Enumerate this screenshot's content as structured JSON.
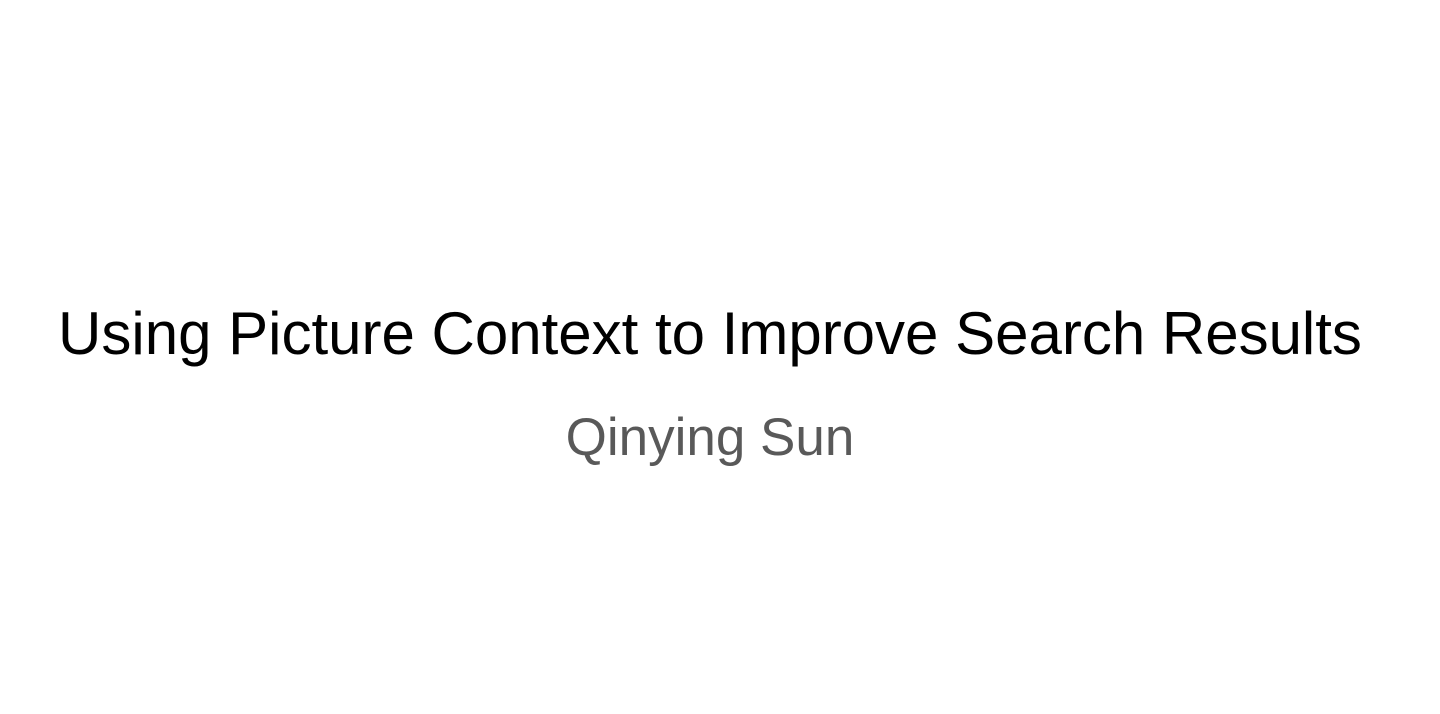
{
  "slide": {
    "title": "Using Picture Context to Improve Search Results",
    "subtitle": "Qinying Sun"
  },
  "colors": {
    "background": "#ffffff",
    "title": "#000000",
    "subtitle": "#595959"
  }
}
